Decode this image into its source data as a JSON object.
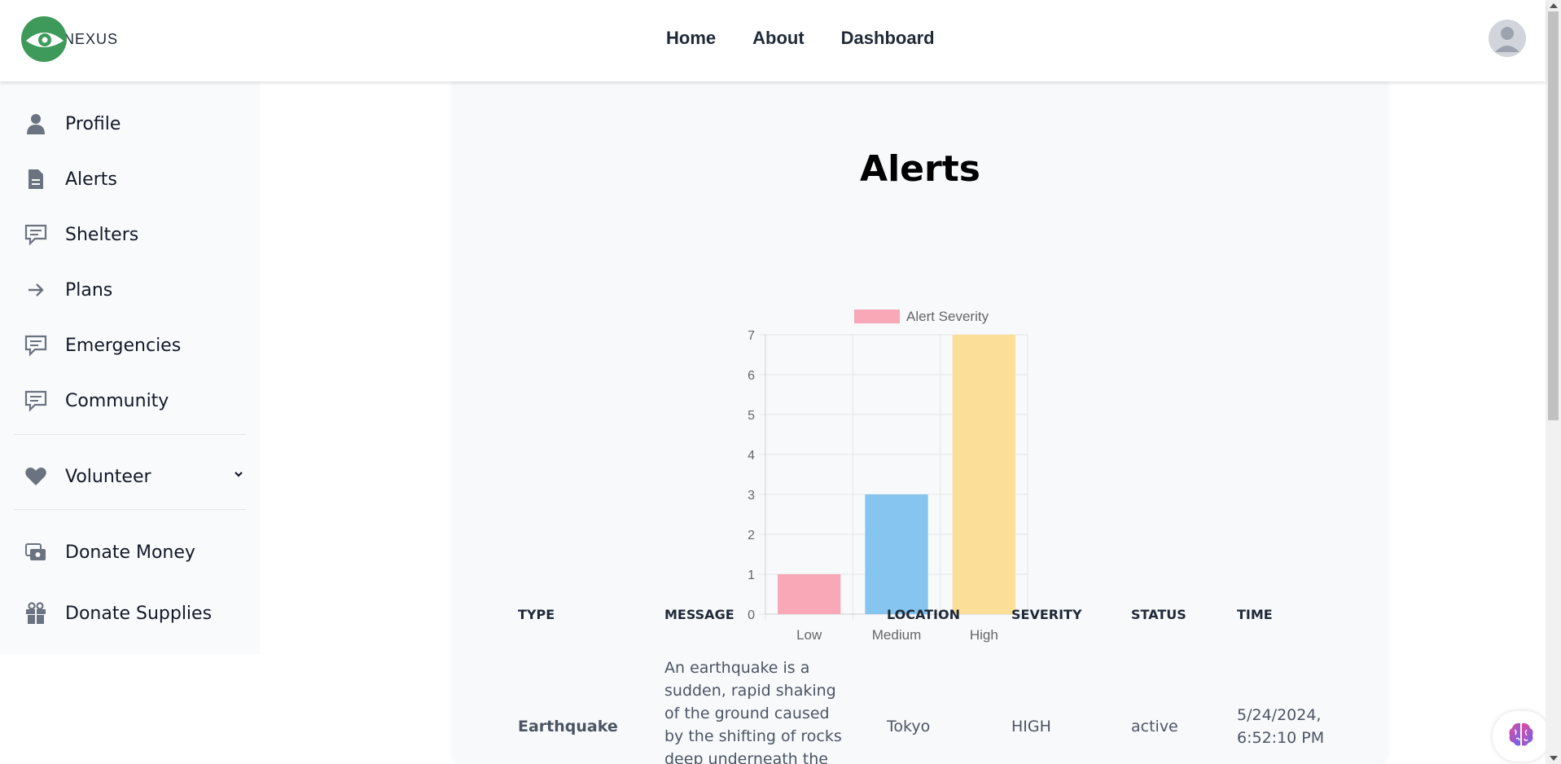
{
  "brand": {
    "logo_text": "NEXUS"
  },
  "nav": {
    "home": "Home",
    "about": "About",
    "dashboard": "Dashboard"
  },
  "sidebar": {
    "items": [
      {
        "label": "Profile",
        "icon": "user-icon"
      },
      {
        "label": "Alerts",
        "icon": "document-icon"
      },
      {
        "label": "Shelters",
        "icon": "chat-icon"
      },
      {
        "label": "Plans",
        "icon": "arrow-right-icon"
      },
      {
        "label": "Emergencies",
        "icon": "chat-icon"
      },
      {
        "label": "Community",
        "icon": "chat-icon"
      },
      {
        "label": "Volunteer",
        "icon": "heart-icon"
      },
      {
        "label": "Donate Money",
        "icon": "cash-icon"
      },
      {
        "label": "Donate Supplies",
        "icon": "gift-icon"
      }
    ]
  },
  "main": {
    "title": "Alerts",
    "table": {
      "headers": [
        "TYPE",
        "MESSAGE",
        "LOCATION",
        "SEVERITY",
        "STATUS",
        "TIME"
      ],
      "rows": [
        {
          "type": "Earthquake",
          "message_lines": [
            "An earthquake is a",
            "sudden, rapid shaking",
            "of the ground caused",
            "by the shifting of rocks",
            "deep underneath the"
          ],
          "location": "Tokyo",
          "severity": "HIGH",
          "status": "active",
          "time_lines": [
            "5/24/2024,",
            "6:52:10 PM"
          ]
        }
      ]
    }
  },
  "chart_data": {
    "type": "bar",
    "categories": [
      "Low",
      "Medium",
      "High"
    ],
    "series": [
      {
        "name": "Alert Severity",
        "values": [
          1,
          3,
          7
        ],
        "colors": [
          "#f9a8b8",
          "#85c5ef",
          "#fbde97"
        ]
      }
    ],
    "yticks": [
      "0",
      "1",
      "2",
      "3",
      "4",
      "5",
      "6",
      "7"
    ],
    "ylim": [
      0,
      7
    ],
    "grid": true,
    "legend": "top"
  }
}
